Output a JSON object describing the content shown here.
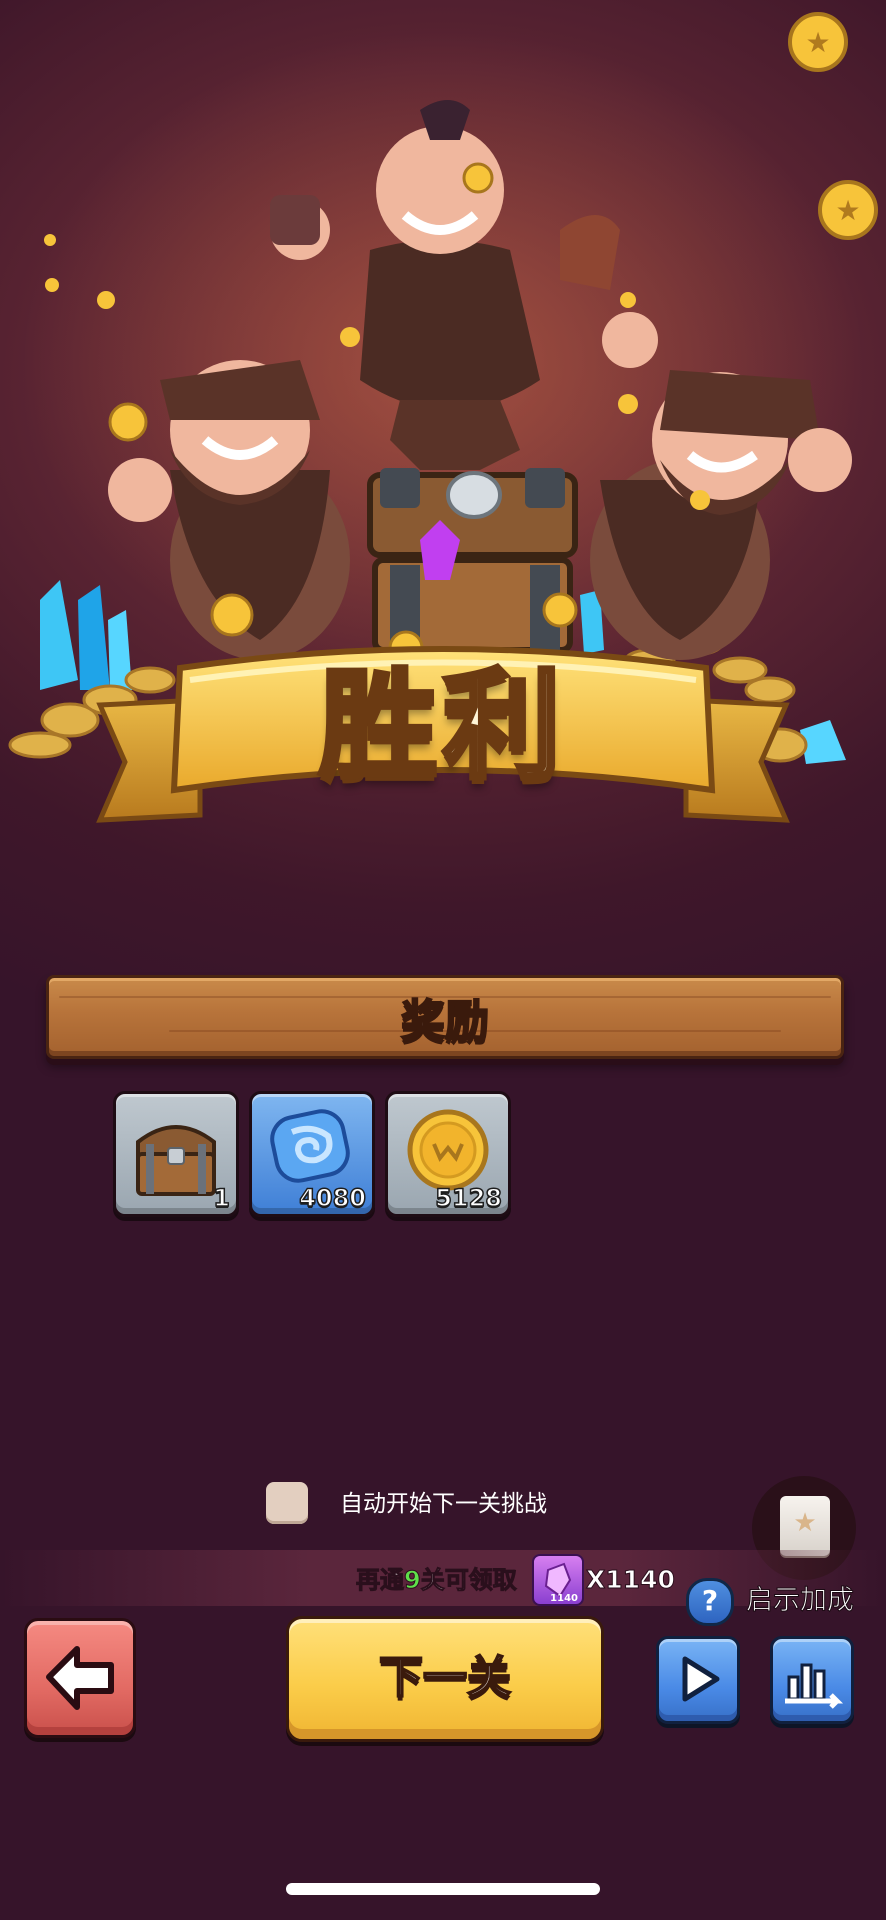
{
  "banner": {
    "title": "胜利"
  },
  "rewards": {
    "header": "奖励",
    "items": [
      {
        "name": "treasure-chest",
        "count": "1"
      },
      {
        "name": "blue-stone",
        "count": "4080"
      },
      {
        "name": "gold-coin",
        "count": "5128"
      }
    ]
  },
  "auto_next": {
    "label": "自动开始下一关挑战",
    "checked": false
  },
  "progress": {
    "prefix": "再通",
    "levels": "9",
    "suffix": "关可领取",
    "gem_badge": "1140",
    "multiplier": "X1140"
  },
  "hint_bonus": {
    "label": "启示加成",
    "help_glyph": "?"
  },
  "buttons": {
    "next_level": "下一关"
  },
  "colors": {
    "accent_gold": "#fbcd4a",
    "back_red": "#e26a63",
    "action_blue": "#4a8ae6",
    "progress_green": "#5fe04a"
  },
  "icons": [
    "back-arrow-icon",
    "play-icon",
    "stats-chart-icon",
    "help-icon",
    "star-card-icon",
    "gem-icon"
  ]
}
